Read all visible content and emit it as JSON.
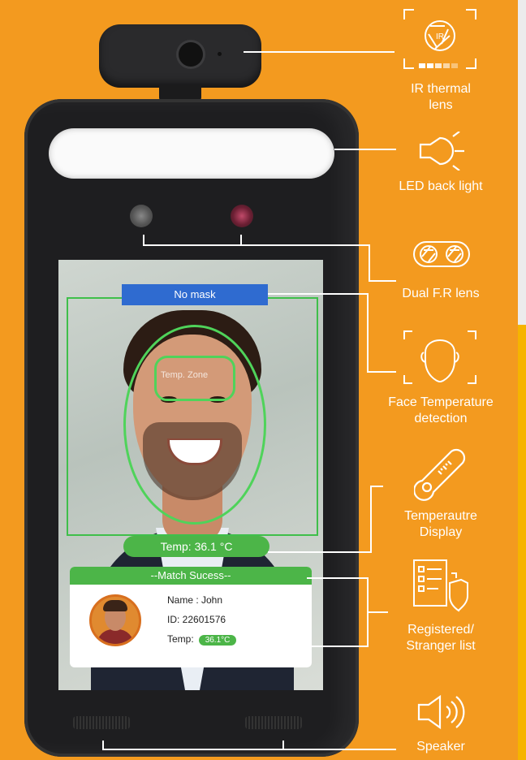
{
  "screen": {
    "status_banner": "No mask",
    "forehead_label": "Temp. Zone",
    "temp_readout": "Temp: 36.1 °C",
    "match_header": "--Match Sucess--",
    "name_line": "Name : John",
    "id_line": "ID: 22601576",
    "temp_label": "Temp:",
    "temp_badge": "36.1°C"
  },
  "features": [
    {
      "label_line1": "IR  thermal",
      "label_line2": "lens",
      "icon": "ir-aperture-icon"
    },
    {
      "label_line1": "LED back light",
      "icon": "bulb-icon"
    },
    {
      "label_line1": "Dual F.R lens",
      "icon": "dual-lens-icon"
    },
    {
      "label_line1": "Face Temperature",
      "label_line2": "detection",
      "icon": "face-scan-icon"
    },
    {
      "label_line1": "Temperautre",
      "label_line2": "Display",
      "icon": "thermometer-icon"
    },
    {
      "label_line1": "Registered/",
      "label_line2": "Stranger list",
      "icon": "checklist-shield-icon"
    },
    {
      "label_line1": "Speaker",
      "icon": "speaker-icon"
    }
  ],
  "colors": {
    "background": "#f39a1f",
    "accent_green": "#4cb548",
    "banner_blue": "#2f6bd0"
  }
}
